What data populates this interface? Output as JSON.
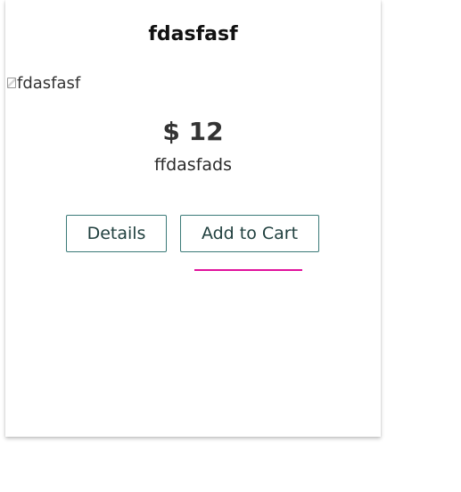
{
  "product": {
    "name": "fdasfasf",
    "image_alt": "fdasfasf",
    "price": "$ 12",
    "description": "ffdasfads"
  },
  "actions": {
    "details_label": "Details",
    "add_to_cart_label": "Add to Cart"
  },
  "colors": {
    "button_border": "#3b7a78",
    "focus_underline": "#e0119c"
  },
  "icons": {
    "image_placeholder": "broken-image-icon"
  }
}
